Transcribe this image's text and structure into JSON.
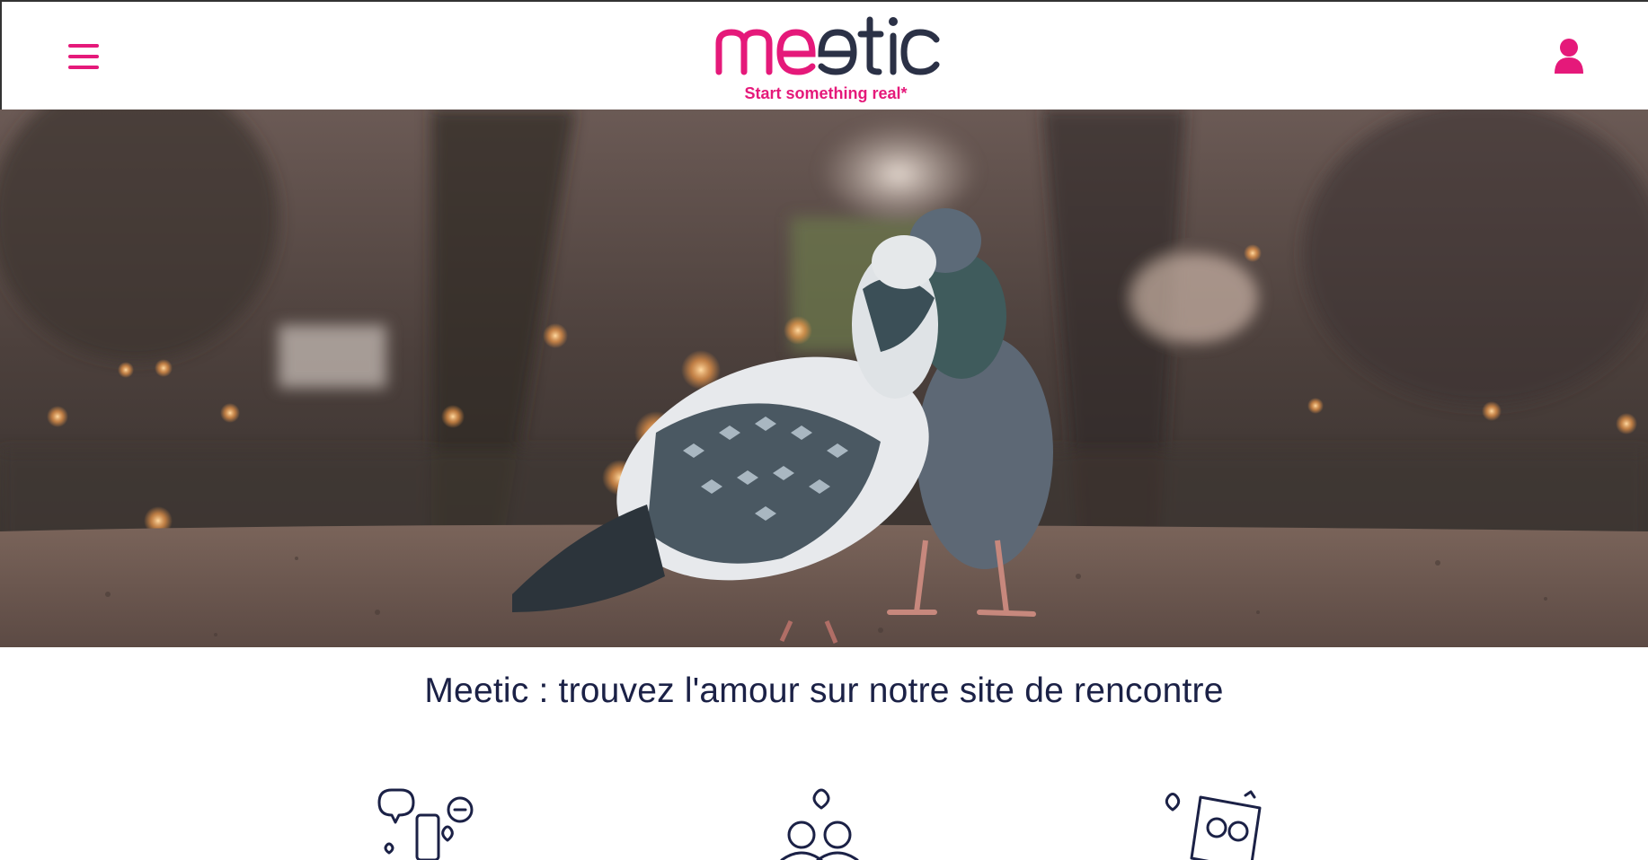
{
  "header": {
    "logo_text": "meetic",
    "tagline": "Start something real*"
  },
  "hero": {
    "image_alt": "Two pigeons kissing on a ledge with a blurred Paris background"
  },
  "main": {
    "headline": "Meetic : trouvez l'amour sur notre site de rencontre"
  },
  "colors": {
    "brand_pink": "#e5197a",
    "logo_dark": "#2b3146",
    "headline_navy": "#1b2146"
  },
  "icons": {
    "menu": "hamburger-icon",
    "user": "user-icon",
    "features": [
      "chat-phone-icon",
      "couple-heart-icon",
      "photo-frame-couple-icon"
    ]
  }
}
